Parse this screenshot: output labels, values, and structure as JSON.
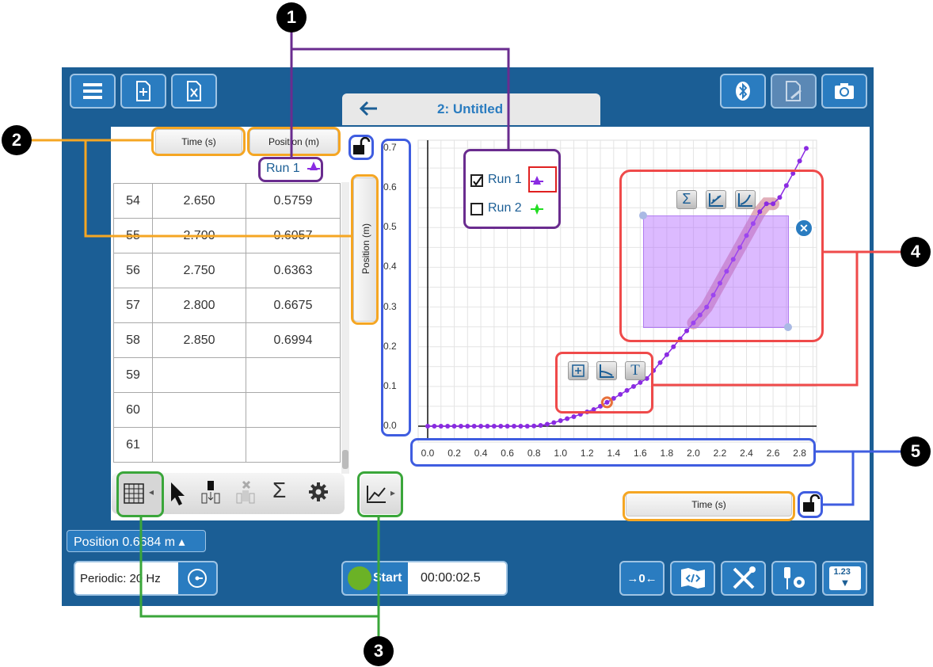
{
  "window": {
    "tab_title": "2: Untitled"
  },
  "table": {
    "headers": [
      "Time (s)",
      "Position (m)"
    ],
    "run_label": "Run 1",
    "rows": [
      {
        "idx": "54",
        "time": "2.650",
        "pos": "0.5759"
      },
      {
        "idx": "55",
        "time": "2.700",
        "pos": "0.6057"
      },
      {
        "idx": "56",
        "time": "2.750",
        "pos": "0.6363"
      },
      {
        "idx": "57",
        "time": "2.800",
        "pos": "0.6675"
      },
      {
        "idx": "58",
        "time": "2.850",
        "pos": "0.6994"
      },
      {
        "idx": "59",
        "time": "",
        "pos": ""
      },
      {
        "idx": "60",
        "time": "",
        "pos": ""
      },
      {
        "idx": "61",
        "time": "",
        "pos": ""
      }
    ]
  },
  "graph": {
    "y_axis_button": "Position (m)",
    "x_axis_button": "Time (s)",
    "legend": [
      {
        "label": "Run 1",
        "checked": true,
        "color": "#8a2be2"
      },
      {
        "label": "Run 2",
        "checked": false,
        "color": "#22dd22"
      }
    ]
  },
  "chart_data": {
    "type": "scatter",
    "xlabel": "Time (s)",
    "ylabel": "Position (m)",
    "xlim": [
      0,
      2.85
    ],
    "ylim": [
      0,
      0.7
    ],
    "x_ticks": [
      "0.0",
      "0.2",
      "0.4",
      "0.6",
      "0.8",
      "1.0",
      "1.2",
      "1.4",
      "1.6",
      "1.8",
      "2.0",
      "2.2",
      "2.4",
      "2.6",
      "2.8"
    ],
    "y_ticks": [
      "0.0",
      "0.1",
      "0.2",
      "0.3",
      "0.4",
      "0.5",
      "0.6",
      "0.7"
    ],
    "series": [
      {
        "name": "Run 1",
        "color": "#8a2be2",
        "x": [
          0,
          0.05,
          0.1,
          0.15,
          0.2,
          0.25,
          0.3,
          0.35,
          0.4,
          0.45,
          0.5,
          0.55,
          0.6,
          0.65,
          0.7,
          0.75,
          0.8,
          0.85,
          0.9,
          0.95,
          1.0,
          1.05,
          1.1,
          1.15,
          1.2,
          1.25,
          1.3,
          1.35,
          1.4,
          1.45,
          1.5,
          1.55,
          1.6,
          1.65,
          1.7,
          1.75,
          1.8,
          1.85,
          1.9,
          1.95,
          2.0,
          2.05,
          2.1,
          2.15,
          2.2,
          2.25,
          2.3,
          2.35,
          2.4,
          2.45,
          2.5,
          2.55,
          2.6,
          2.65,
          2.7,
          2.75,
          2.8,
          2.85
        ],
        "y": [
          0,
          0,
          0,
          0,
          0,
          0,
          0,
          0,
          0,
          0,
          0,
          0,
          0,
          0,
          0,
          0,
          0.0005,
          0.002,
          0.005,
          0.009,
          0.014,
          0.019,
          0.024,
          0.03,
          0.036,
          0.042,
          0.05,
          0.06,
          0.07,
          0.08,
          0.09,
          0.1,
          0.11,
          0.12,
          0.14,
          0.16,
          0.18,
          0.2,
          0.22,
          0.24,
          0.26,
          0.28,
          0.3,
          0.33,
          0.36,
          0.39,
          0.42,
          0.45,
          0.48,
          0.51,
          0.54,
          0.56,
          0.56,
          0.5759,
          0.6057,
          0.6363,
          0.6675,
          0.6994
        ]
      }
    ]
  },
  "status": {
    "sensor_label": "Position",
    "sensor_value": "0.6684",
    "sensor_unit": "m",
    "sampling": "Periodic: 20 Hz",
    "start_label": "Start",
    "timer": "00:00:02.5",
    "zero_label": "→0←",
    "meter_label": "1.23"
  },
  "callouts": [
    "1",
    "2",
    "3",
    "4",
    "5"
  ],
  "colors": {
    "app_blue": "#1b5e95",
    "button_blue": "#2a7cc0",
    "callout_purple": "#6a2c8f",
    "callout_orange": "#f5a623",
    "callout_blue": "#3f5de0",
    "callout_red": "#ef4a4a",
    "callout_green": "#3aa63a"
  }
}
